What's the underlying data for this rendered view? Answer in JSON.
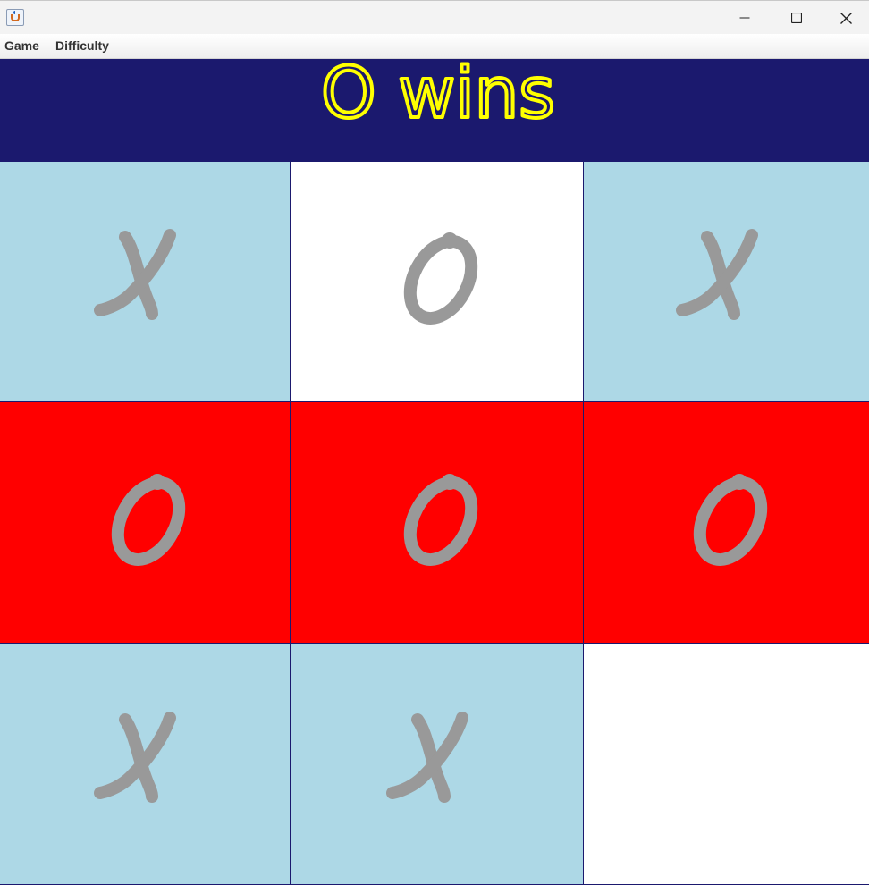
{
  "window": {
    "icon": "java-cup-icon",
    "controls": [
      "minimize-icon",
      "maximize-icon",
      "close-icon"
    ]
  },
  "menu": {
    "game_label": "Game",
    "difficulty_label": "Difficulty"
  },
  "status": {
    "text": "O wins",
    "color": "#ffff00",
    "background": "#1b196e"
  },
  "colors": {
    "x_cell": "#add8e6",
    "empty_cell": "#ffffff",
    "winning_cell": "#ff0000",
    "mark": "#999999",
    "grid_line": "#1b196e"
  },
  "board": {
    "cells": [
      {
        "row": 1,
        "col": 1,
        "mark": "X",
        "state": "x"
      },
      {
        "row": 1,
        "col": 2,
        "mark": "O",
        "state": "empty"
      },
      {
        "row": 1,
        "col": 3,
        "mark": "X",
        "state": "x"
      },
      {
        "row": 2,
        "col": 1,
        "mark": "O",
        "state": "winning"
      },
      {
        "row": 2,
        "col": 2,
        "mark": "O",
        "state": "winning"
      },
      {
        "row": 2,
        "col": 3,
        "mark": "O",
        "state": "winning"
      },
      {
        "row": 3,
        "col": 1,
        "mark": "X",
        "state": "x"
      },
      {
        "row": 3,
        "col": 2,
        "mark": "X",
        "state": "x"
      },
      {
        "row": 3,
        "col": 3,
        "mark": "",
        "state": "empty"
      }
    ]
  }
}
